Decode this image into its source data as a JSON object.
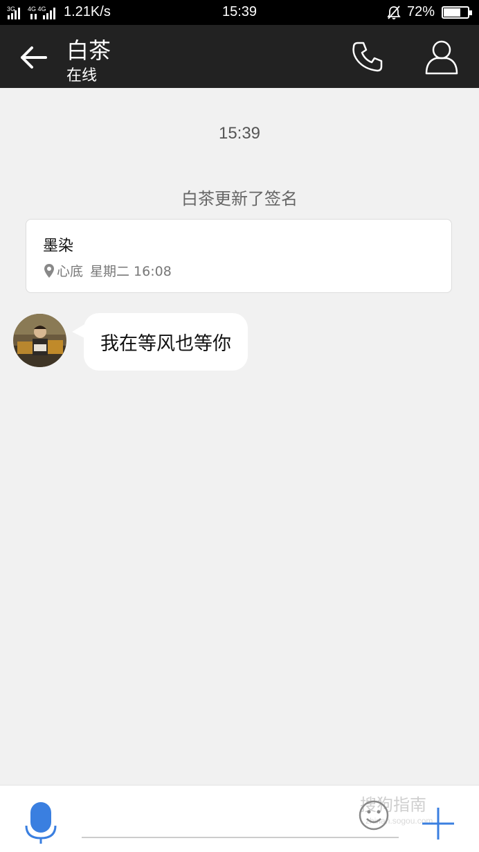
{
  "status_bar": {
    "network_left": "3G",
    "network_right": "4G 4G",
    "speed": "1.21K/s",
    "time": "15:39",
    "battery_percent": "72%",
    "battery_level": 0.72
  },
  "header": {
    "contact_name": "白茶",
    "contact_status": "在线",
    "icons": [
      "back-arrow-icon",
      "phone-icon",
      "person-icon"
    ]
  },
  "chat": {
    "timestamp": "15:39",
    "system_message": "白茶更新了签名",
    "signature_card": {
      "title": "墨染",
      "location": "心底",
      "time": "星期二 16:08"
    },
    "messages": [
      {
        "sender": "白茶",
        "text": "我在等风也等你"
      }
    ]
  },
  "input_bar": {
    "placeholder": "",
    "watermark": "搜狗指南",
    "watermark_sub": "zhinan.sogou.com",
    "icons": [
      "microphone-icon",
      "emoji-icon",
      "plus-icon"
    ]
  },
  "colors": {
    "header_bg": "#222222",
    "status_bg": "#000000",
    "chat_bg": "#f1f1f1",
    "accent_blue": "#3a7fe0"
  }
}
